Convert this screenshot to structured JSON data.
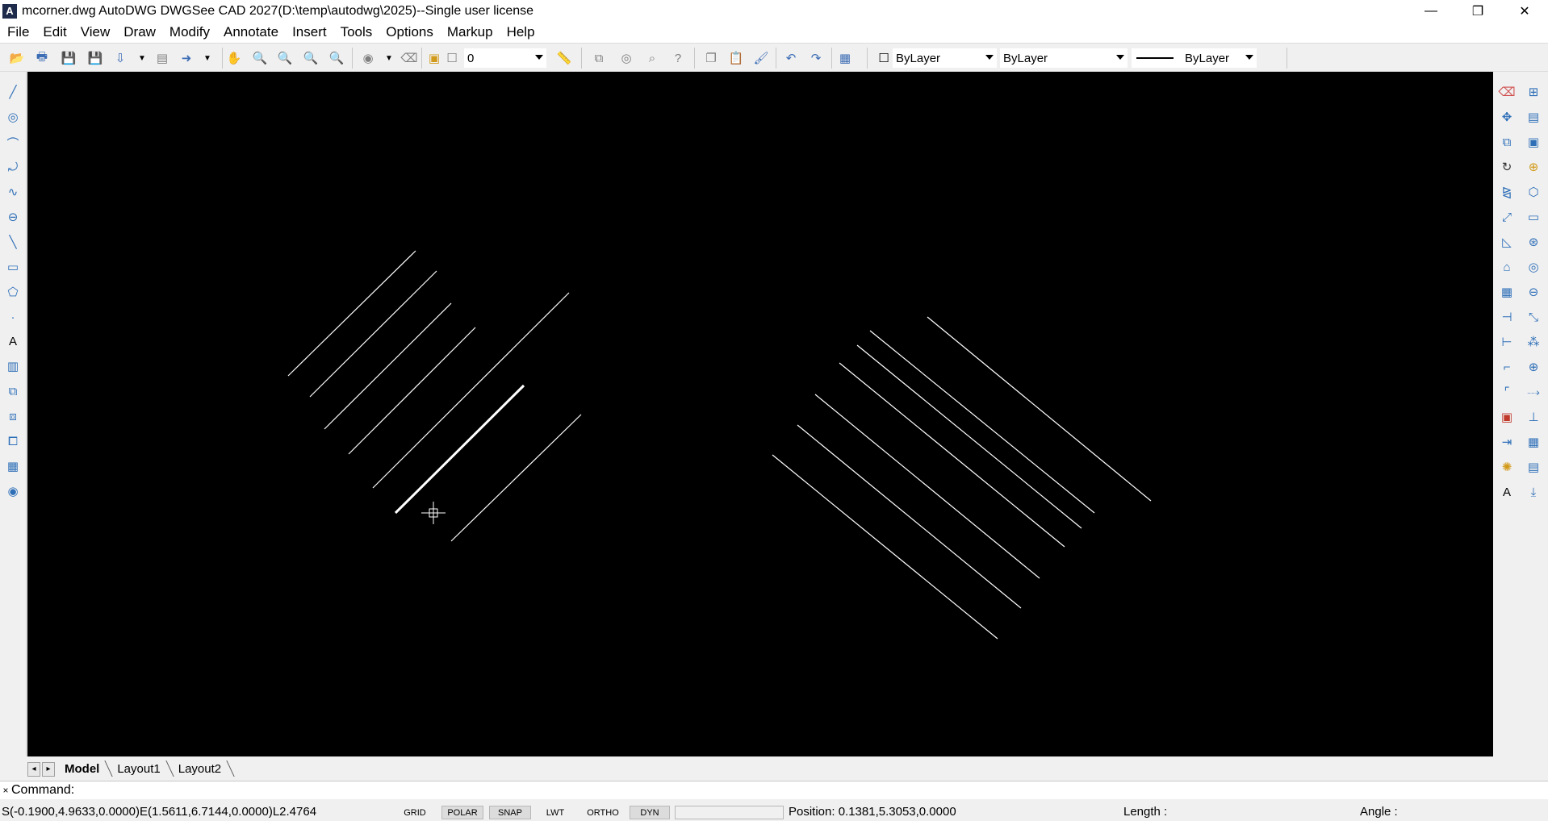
{
  "window": {
    "title": "mcorner.dwg AutoDWG DWGSee CAD 2027(D:\\temp\\autodwg\\2025)--Single user license",
    "minimize": "—",
    "restore": "❐",
    "close": "✕"
  },
  "menu": [
    "File",
    "Edit",
    "View",
    "Draw",
    "Modify",
    "Annotate",
    "Insert",
    "Tools",
    "Options",
    "Markup",
    "Help"
  ],
  "toolbar": {
    "layer_value": "0",
    "color_value": "ByLayer",
    "linetype_value": "ByLayer",
    "lineweight_value": "ByLayer"
  },
  "layout_tabs": [
    "Model",
    "Layout1",
    "Layout2"
  ],
  "command": {
    "label": "Command:",
    "value": ""
  },
  "status": {
    "segment_info": "S(-0.1900,4.9633,0.0000)E(1.5611,6.7144,0.0000)L2.4764",
    "modes": [
      "GRID",
      "POLAR",
      "SNAP",
      "LWT",
      "ORTHO",
      "DYN"
    ],
    "position": "Position: 0.1381,5.3053,0.0000",
    "length": "Length :",
    "angle": "Angle :"
  },
  "colors": {
    "canvas": "#000000",
    "lines": "#ffffff",
    "icon_accent": "#2e6fb8"
  }
}
